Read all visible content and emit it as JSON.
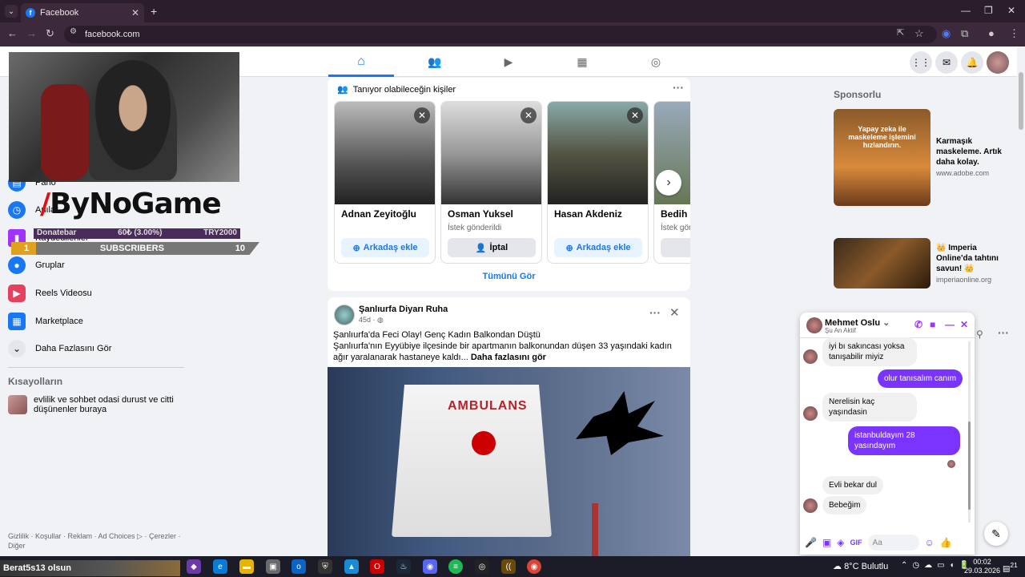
{
  "browser": {
    "tab_title": "Facebook",
    "tab_favicon": "f",
    "url": "facebook.com"
  },
  "overlay": {
    "logo_text": "ByNoGame",
    "donate_label": "Donatebar",
    "donate_amount": "60₺ (3.00%)",
    "donate_goal": "TRY2000",
    "subs_left": "1",
    "subs_label": "SUBSCRIBERS",
    "subs_right": "10",
    "ticker": "Berat5s13 olsun"
  },
  "sidebar": {
    "items": [
      {
        "label": "Pano",
        "icon": "dashboard-icon",
        "color": "#1877f2"
      },
      {
        "label": "Anılar",
        "icon": "clock-icon",
        "color": "#1877f2"
      },
      {
        "label": "Kaydedilenler",
        "icon": "bookmark-icon",
        "color": "#a033ff"
      },
      {
        "label": "Gruplar",
        "icon": "groups-icon",
        "color": "#1877f2"
      },
      {
        "label": "Reels Videosu",
        "icon": "reels-icon",
        "color": "#e4405f"
      },
      {
        "label": "Marketplace",
        "icon": "store-icon",
        "color": "#1877f2"
      },
      {
        "label": "Daha Fazlasını Gör",
        "icon": "chevron-down-icon",
        "color": "#e4e6eb"
      }
    ],
    "shortcuts_title": "Kısayolların",
    "shortcut_label": "evlilik ve sohbet odasi durust ve citti düşünenler buraya",
    "footer": "Gizlilik · Koşullar · Reklam · Ad Choices ▷ · Çerezler · Diğer"
  },
  "suggestions": {
    "title": "Tanıyor olabileceğin kişiler",
    "people": [
      {
        "name": "Adnan Zeyitoğlu",
        "status": "",
        "button": "Arkadaş ekle"
      },
      {
        "name": "Osman Yuksel",
        "status": "İstek gönderildi",
        "button": "İptal"
      },
      {
        "name": "Hasan Akdeniz",
        "status": "",
        "button": "Arkadaş ekle"
      },
      {
        "name": "Bedih G",
        "status": "İstek gön",
        "button": ""
      }
    ],
    "see_all": "Tümünü Gör"
  },
  "post": {
    "page_name": "Şanlıurfa Diyarı Ruha",
    "time": "45d ·",
    "line1": "Şanlıurfa'da Feci Olay! Genç Kadın Balkondan Düştü",
    "line2": "Şanlıurfa'nın Eyyübiye ilçesinde bir apartmanın balkonundan düşen 33 yaşındaki kadın ağır yaralanarak hastaneye kaldı...",
    "see_more": "Daha fazlasını gör",
    "image_text": "AMBULANS"
  },
  "sponsored": {
    "title": "Sponsorlu",
    "ads": [
      {
        "title": "Karmaşık maskeleme. Artık daha kolay.",
        "url": "www.adobe.com",
        "image_text": "Yapay zeka ile maskeleme işlemini hızlandırın."
      },
      {
        "title": "👑 Imperia Online'da tahtını savun! 👑",
        "url": "imperiaonline.org"
      }
    ]
  },
  "chat": {
    "name": "Mehmet Oslu",
    "status": "Şu An Aktif",
    "messages": [
      {
        "dir": "in",
        "text": "iyi bı sakıncası yoksa tanışabilir miyiz"
      },
      {
        "dir": "out",
        "text": "olur tanısalım canım"
      },
      {
        "dir": "in",
        "text": "Nerelisin kaç yaşındasin"
      },
      {
        "dir": "out",
        "text": "istanbuldayım 28 yasındayım"
      },
      {
        "dir": "in",
        "text": "Evli bekar dul"
      },
      {
        "dir": "in",
        "text": "Bebeğim"
      }
    ],
    "input_placeholder": "Aa"
  },
  "taskbar": {
    "weather": "8°C  Bulutlu",
    "time": "00:02",
    "date": "29.03.2026",
    "notif": "21"
  },
  "colors": {
    "fb_blue": "#1877f2",
    "messenger_purple": "#7b34ff",
    "browser_dark": "#2b1d2b"
  }
}
